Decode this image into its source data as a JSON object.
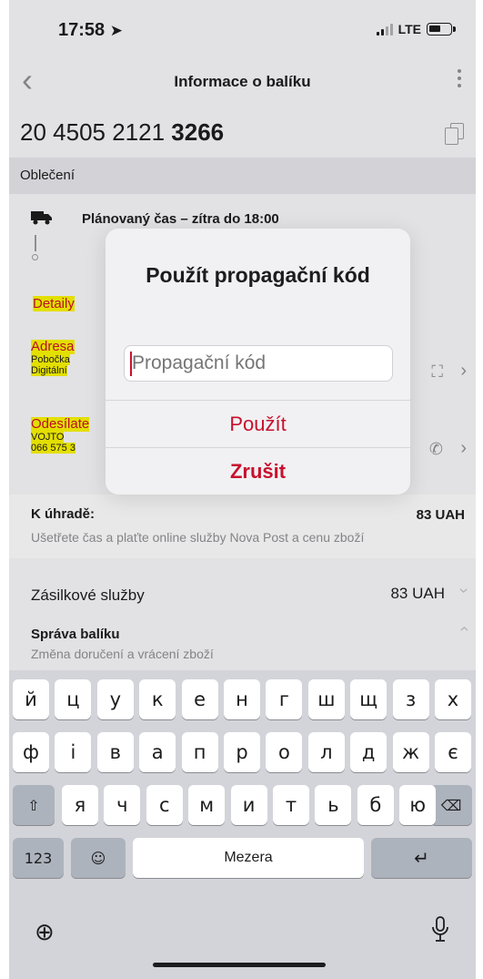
{
  "status_bar": {
    "time": "17:58",
    "location_arrow": "location-arrow-icon",
    "network": "LTE"
  },
  "nav": {
    "back_icon": "chevron-left-icon",
    "title": "Informace o balíku",
    "more_icon": "more-vertical-icon"
  },
  "parcel": {
    "tracking_prefix": "20 4505 2121 ",
    "tracking_suffix": "3266",
    "copy_icon": "copy-icon"
  },
  "section": {
    "label": "Oblečení"
  },
  "delivery": {
    "planned": "Plánovaný čas – zítra do 18:00",
    "truck_icon": "truck-icon"
  },
  "details": {
    "detaily": "Detaily",
    "address_title": "Adresa",
    "address_line1": "Pobočka",
    "address_line2": "Digitální",
    "sender_title": "Odesílate",
    "sender_line1": "VOJTO",
    "sender_line2": "066 575 3"
  },
  "payment": {
    "label": "K úhradě:",
    "amount": "83 UAH",
    "note": "Ušetřete čas a plaťte online služby Nova Post a cenu zboží"
  },
  "services": {
    "label": "Zásilkové služby",
    "amount": "83 UAH"
  },
  "management": {
    "label": "Správa balíku",
    "sub": "Změna doručení a vrácení zboží"
  },
  "dialog": {
    "title": "Použít propagační kód",
    "input_placeholder": "Propagační kód",
    "apply_label": "Použít",
    "cancel_label": "Zrušit"
  },
  "keyboard": {
    "row1": [
      "й",
      "ц",
      "у",
      "к",
      "е",
      "н",
      "г",
      "ш",
      "щ",
      "з",
      "х"
    ],
    "row2": [
      "ф",
      "і",
      "в",
      "а",
      "п",
      "р",
      "о",
      "л",
      "д",
      "ж",
      "є"
    ],
    "row3": [
      "я",
      "ч",
      "с",
      "м",
      "и",
      "т",
      "ь",
      "б",
      "ю"
    ],
    "numbers_label": "123",
    "space_label": "Mezera",
    "shift_icon": "shift-icon",
    "backspace_icon": "backspace-icon",
    "emoji_icon": "emoji-icon",
    "return_icon": "return-icon",
    "globe_icon": "globe-icon",
    "mic_icon": "microphone-icon"
  },
  "colors": {
    "accent": "#c8102e",
    "highlight": "#f5f000",
    "keyboard_bg": "#d3d4d9"
  }
}
